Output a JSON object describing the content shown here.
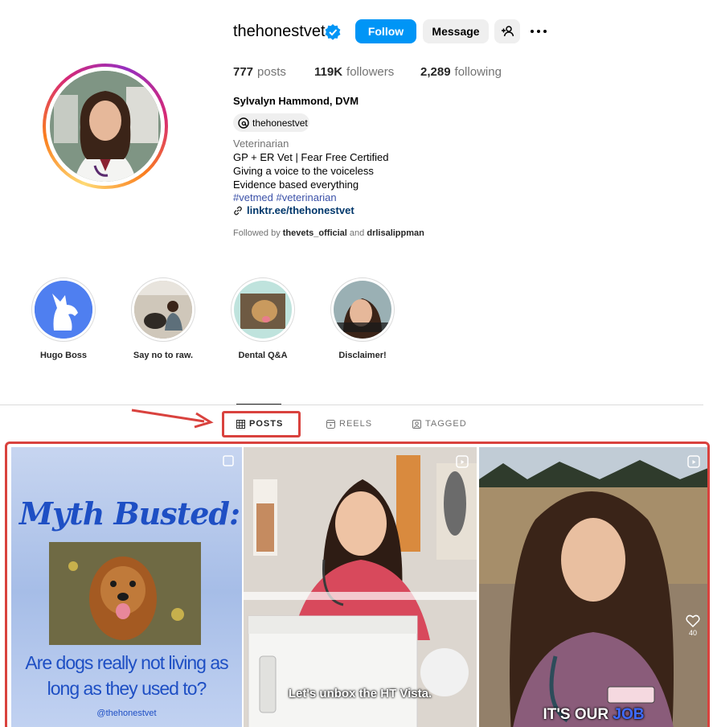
{
  "profile": {
    "username": "thehonestvet",
    "follow_label": "Follow",
    "message_label": "Message",
    "stats": {
      "posts_count": "777",
      "posts_label": "posts",
      "followers_count": "119K",
      "followers_label": "followers",
      "following_count": "2,289",
      "following_label": "following"
    },
    "full_name": "Sylvalyn Hammond, DVM",
    "threads_handle": "thehonestvet",
    "category": "Veterinarian",
    "bio_lines": [
      "GP + ER Vet | Fear Free Certified",
      "Giving a voice to the voiceless",
      "Evidence based everything"
    ],
    "hashtags": "#vetmed #veterinarian",
    "link": "linktr.ee/thehonestvet",
    "followed_by_prefix": "Followed by",
    "followed_by_1": "thevets_official",
    "followed_by_and": "and",
    "followed_by_2": "drlisalippman"
  },
  "highlights": [
    {
      "label": "Hugo Boss"
    },
    {
      "label": "Say no to raw."
    },
    {
      "label": "Dental Q&A"
    },
    {
      "label": "Disclaimer!"
    }
  ],
  "tabs": {
    "posts": "POSTS",
    "reels": "REELS",
    "tagged": "TAGGED"
  },
  "posts": {
    "tile1": {
      "headline": "Myth Busted:",
      "question_line1": "Are dogs really not living as",
      "question_line2": "long as they used to?",
      "handle": "@thehonestvet"
    },
    "tile2": {
      "caption": "Let's unbox the HT Vista."
    },
    "tile3": {
      "caption_a": "IT'S OUR",
      "caption_b": "JOB",
      "like_count": "40"
    }
  },
  "colors": {
    "follow_button": "#0095f6",
    "annotation_red": "#d9423e",
    "link": "#00376b",
    "hashtag": "#3b51a8"
  }
}
